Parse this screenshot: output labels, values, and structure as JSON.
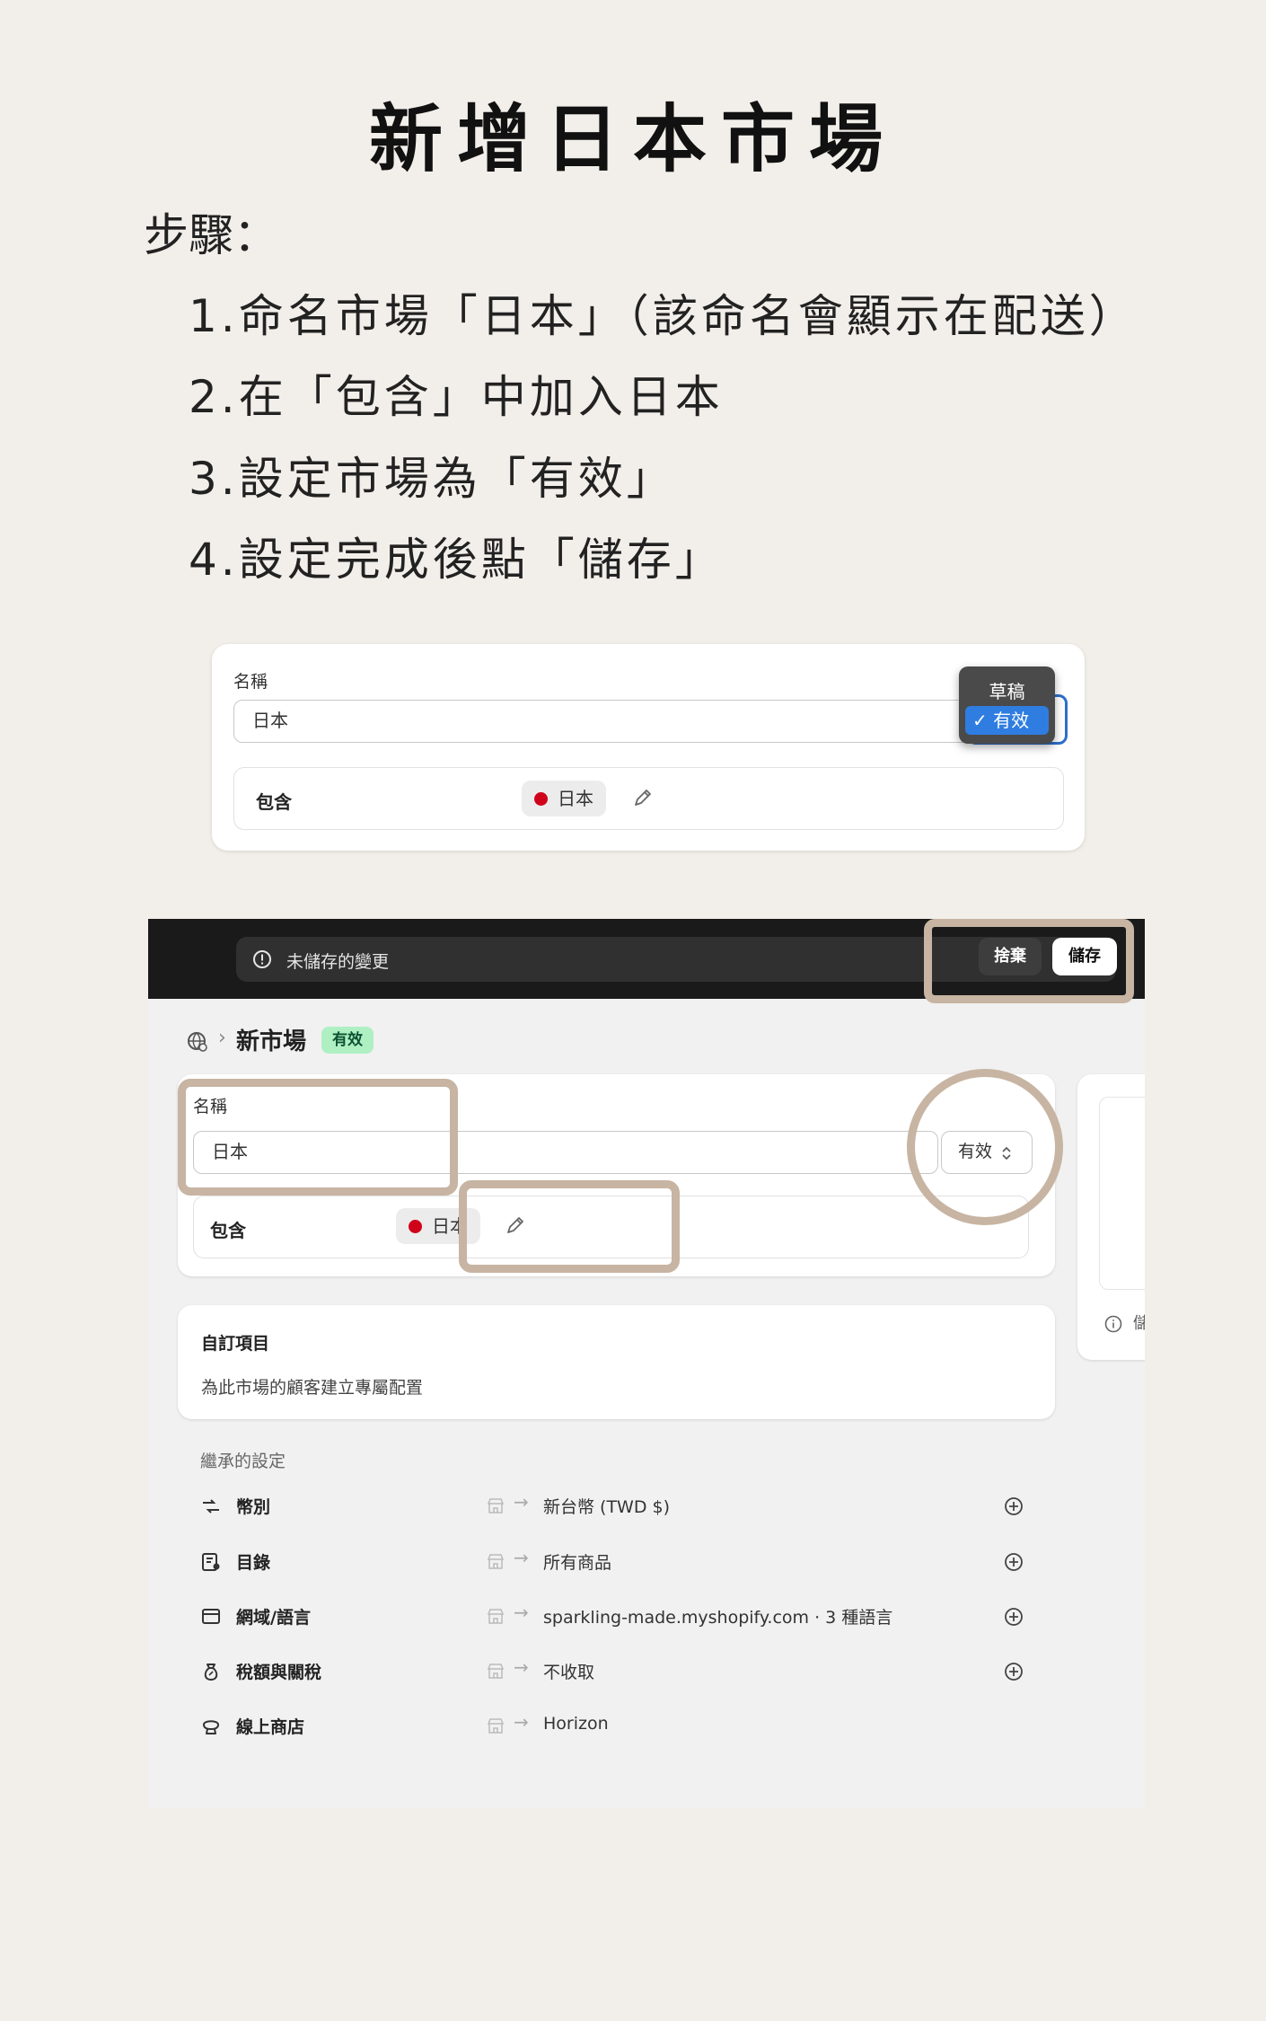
{
  "title": "新增日本市場",
  "steps_label": "步驟：",
  "steps": [
    "1.命名市場「日本」（該命名會顯示在配送）",
    "2.在「包含」中加入日本",
    "3.設定市場為「有效」",
    "4.設定完成後點「儲存」"
  ],
  "card1": {
    "name_label": "名稱",
    "name_value": "日本",
    "include_label": "包含",
    "include_chip": "日本",
    "dropdown": {
      "options": [
        "草稿",
        "有效"
      ],
      "selected": "✓ 有效"
    }
  },
  "shot": {
    "unsaved_text": "未儲存的變更",
    "discard_label": "捨棄",
    "save_label": "儲存",
    "page_title": "新市場",
    "status_badge": "有效",
    "name_label": "名稱",
    "name_value": "日本",
    "status_value": "有效",
    "include_label": "包含",
    "include_chip": "日本",
    "side_text": "儲",
    "custom": {
      "title": "自訂項目",
      "subtitle": "為此市場的顧客建立專屬配置"
    },
    "inherited_title": "繼承的設定",
    "inherited": [
      {
        "label": "幣別",
        "value": "新台幣 (TWD $)",
        "icon": "currency-icon"
      },
      {
        "label": "目錄",
        "value": "所有商品",
        "icon": "catalog-icon"
      },
      {
        "label": "網域/語言",
        "value": "sparkling-made.myshopify.com  ·  3 種語言",
        "icon": "domain-icon"
      },
      {
        "label": "稅額與關稅",
        "value": "不收取",
        "icon": "tax-bag-icon"
      },
      {
        "label": "線上商店",
        "value": "Horizon",
        "icon": "theme-icon"
      }
    ]
  },
  "colors": {
    "accent": "#2c6ecb",
    "highlight": "#c7b4a2",
    "badge_bg": "#aff0c3",
    "badge_text": "#0c5132"
  }
}
